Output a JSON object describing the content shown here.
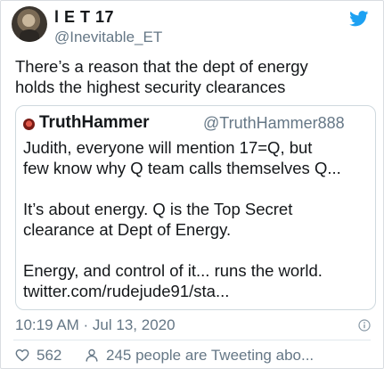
{
  "tweet": {
    "display_name": "l E T 17",
    "handle": "@Inevitable_ET",
    "text": "There’s a reason that the dept of energy\nholds the highest security clearances",
    "timestamp": "10:19 AM · Jul 13, 2020",
    "likes": "562",
    "retweet_text": "245 people are Tweeting abo..."
  },
  "quoted": {
    "display_name": "TruthHammer",
    "handle": "@TruthHammer888",
    "lines": [
      "Judith, everyone will mention 17=Q, but",
      "few know why Q team calls themselves Q...",
      "",
      "It’s about energy. Q is the Top Secret",
      "clearance at Dept of Energy.",
      "",
      "Energy, and control of it... runs the world.",
      "twitter.com/rudejude91/sta..."
    ]
  },
  "icons": {
    "brand": "twitter-bird-icon",
    "info": "info-icon",
    "like": "heart-icon",
    "retweet": "people-icon"
  },
  "colors": {
    "brand_blue": "#1da1f2",
    "muted_text": "#657786",
    "main_text": "#14171a"
  }
}
